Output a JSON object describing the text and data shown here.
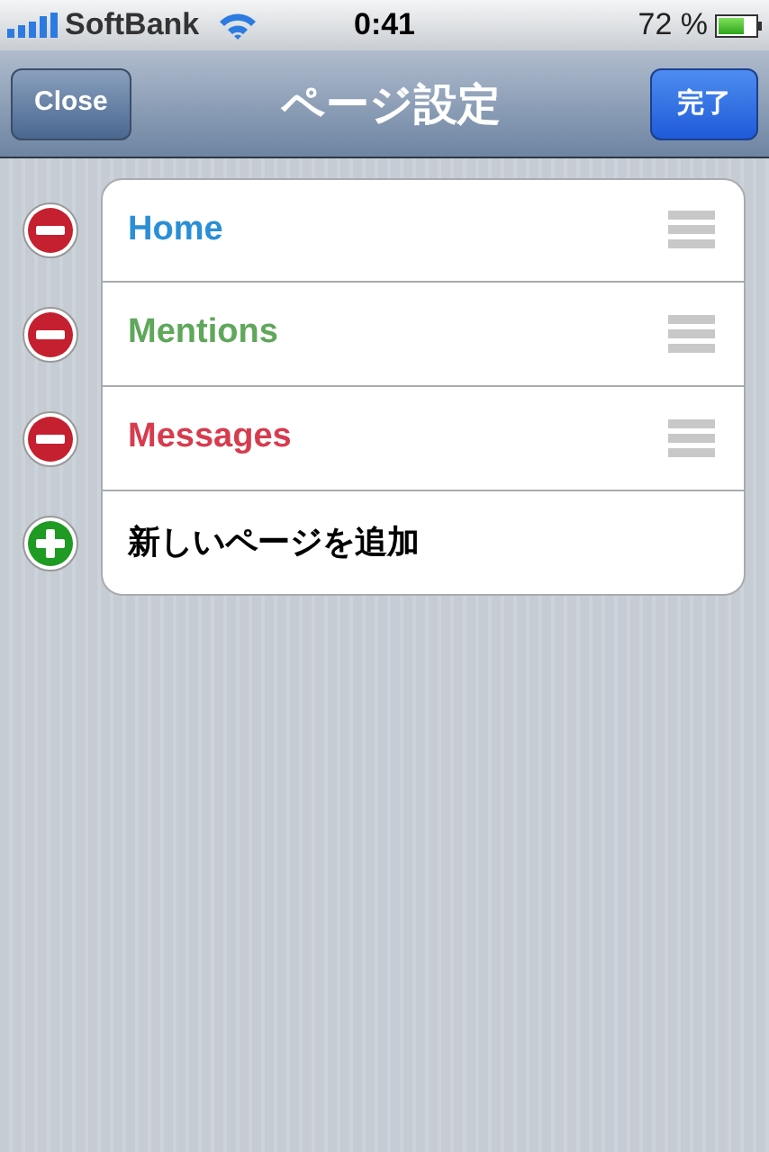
{
  "status_bar": {
    "carrier": "SoftBank",
    "time": "0:41",
    "battery": "72 %"
  },
  "nav_bar": {
    "left_button": "Close",
    "title": "ページ設定",
    "right_button": "完了"
  },
  "rows": [
    {
      "kind": "page",
      "label": "Home",
      "color": "#2a8fd6"
    },
    {
      "kind": "page",
      "label": "Mentions",
      "color": "#5fa75a"
    },
    {
      "kind": "page",
      "label": "Messages",
      "color": "#d63c4e"
    },
    {
      "kind": "add",
      "label": "新しいページを追加"
    }
  ]
}
